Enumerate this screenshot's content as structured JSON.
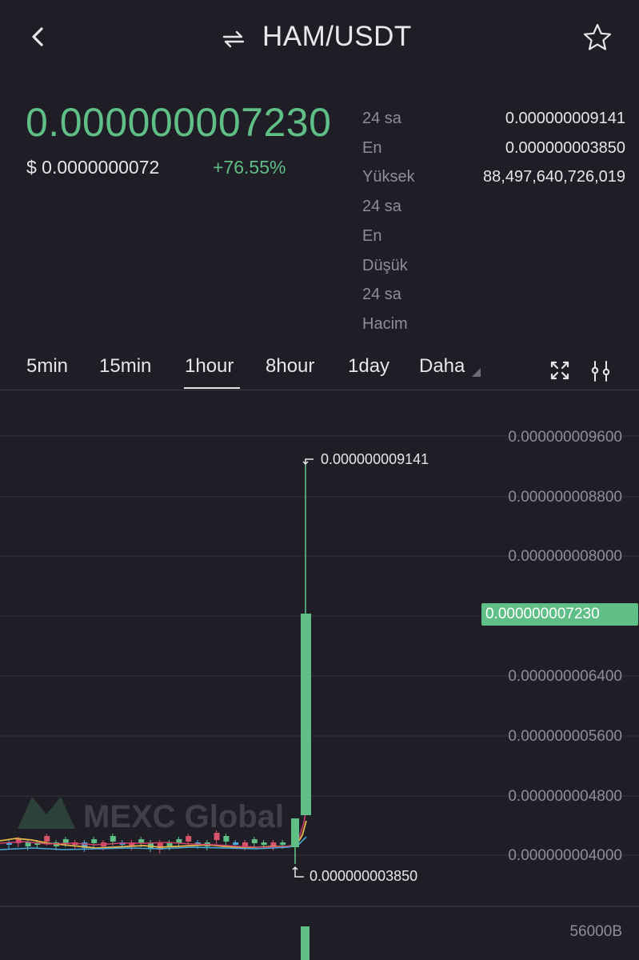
{
  "header": {
    "pair": "HAM/USDT"
  },
  "ticker": {
    "price": "0.000000007230",
    "usd": "$ 0.0000000072",
    "change": "+76.55%"
  },
  "stats": {
    "labels": [
      "24 sa",
      "En",
      "Yüksek",
      "24 sa",
      "En",
      "Düşük",
      "24 sa",
      "Hacim"
    ],
    "values": [
      "0.000000009141",
      "0.000000003850",
      "88,497,640,726,019"
    ]
  },
  "tabs": [
    "5min",
    "15min",
    "1hour",
    "8hour",
    "1day",
    "Daha"
  ],
  "selected_tab": "1hour",
  "chart": {
    "y_labels": [
      "0.000000009600",
      "0.000000008800",
      "0.000000008000",
      "0.000000006400",
      "0.000000005600",
      "0.000000004800",
      "0.000000004000"
    ],
    "current": "0.000000007230",
    "high_mark": "0.000000009141",
    "low_mark": "0.000000003850",
    "volume_label": "56000B",
    "watermark": "MEXC Global",
    "colors": {
      "up": "#5fbf86",
      "down": "#d9546a",
      "ma1": "#e6b84a",
      "ma2": "#c9406a",
      "ma3": "#4aa8d8"
    }
  },
  "chart_data": {
    "type": "candlestick",
    "ylim": [
      3.9e-09,
      9.8e-09
    ],
    "yticks": [
      9.6e-09,
      8.8e-09,
      8e-09,
      6.4e-09,
      5.6e-09,
      4.8e-09,
      4e-09
    ],
    "current_price": 7.23e-09,
    "high": 9.141e-09,
    "low": 3.85e-09,
    "last_candles": [
      {
        "open": 4.1e-09,
        "close": 4.55e-09,
        "high": 4.6e-09,
        "low": 3.85e-09
      },
      {
        "open": 4.6e-09,
        "close": 7.23e-09,
        "high": 9.141e-09,
        "low": 4.6e-09
      }
    ]
  }
}
